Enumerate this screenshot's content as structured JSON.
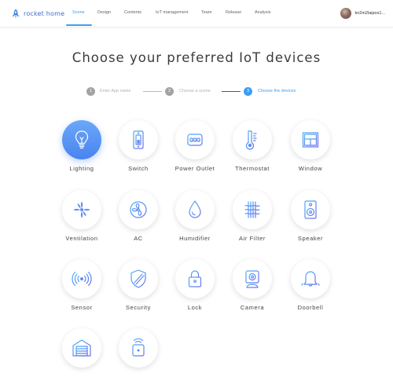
{
  "header": {
    "brand": "rocket home",
    "nav": [
      {
        "label": "Scene",
        "active": true
      },
      {
        "label": "Design",
        "active": false
      },
      {
        "label": "Contents",
        "active": false
      },
      {
        "label": "IoT management",
        "active": false
      },
      {
        "label": "Team",
        "active": false
      },
      {
        "label": "Release",
        "active": false
      },
      {
        "label": "Analysis",
        "active": false
      }
    ],
    "user": {
      "name": "kn2m2laipos1..."
    }
  },
  "main": {
    "title": "Choose your preferred IoT devices",
    "steps": [
      {
        "number": "1",
        "label": "Enter App name",
        "active": false
      },
      {
        "number": "2",
        "label": "Choose a scene",
        "active": false
      },
      {
        "number": "3",
        "label": "Choose the devices",
        "active": true
      }
    ],
    "devices": [
      {
        "label": "Lighting",
        "icon": "bulb-icon",
        "selected": true
      },
      {
        "label": "Switch",
        "icon": "switch-icon",
        "selected": false
      },
      {
        "label": "Power Outlet",
        "icon": "outlet-icon",
        "selected": false
      },
      {
        "label": "Thermostat",
        "icon": "thermometer-icon",
        "selected": false
      },
      {
        "label": "Window",
        "icon": "window-icon",
        "selected": false
      },
      {
        "label": "Ventilation",
        "icon": "fan-icon",
        "selected": false
      },
      {
        "label": "AC",
        "icon": "ac-icon",
        "selected": false
      },
      {
        "label": "Humidifier",
        "icon": "droplet-icon",
        "selected": false
      },
      {
        "label": "Air Filter",
        "icon": "air-filter-icon",
        "selected": false
      },
      {
        "label": "Speaker",
        "icon": "speaker-icon",
        "selected": false
      },
      {
        "label": "Sensor",
        "icon": "sensor-icon",
        "selected": false
      },
      {
        "label": "Security",
        "icon": "shield-icon",
        "selected": false
      },
      {
        "label": "Lock",
        "icon": "lock-icon",
        "selected": false
      },
      {
        "label": "Camera",
        "icon": "camera-icon",
        "selected": false
      },
      {
        "label": "Doorbell",
        "icon": "bell-icon",
        "selected": false
      },
      {
        "label": "",
        "icon": "garage-icon",
        "selected": false
      },
      {
        "label": "",
        "icon": "remote-icon",
        "selected": false
      }
    ]
  },
  "colors": {
    "accent": "#3a9df6",
    "brand": "#3a6fd8",
    "icon_gradient_start": "#4fb0f5",
    "icon_gradient_end": "#6b6ef0",
    "selected_bg": "#5a94f4"
  }
}
